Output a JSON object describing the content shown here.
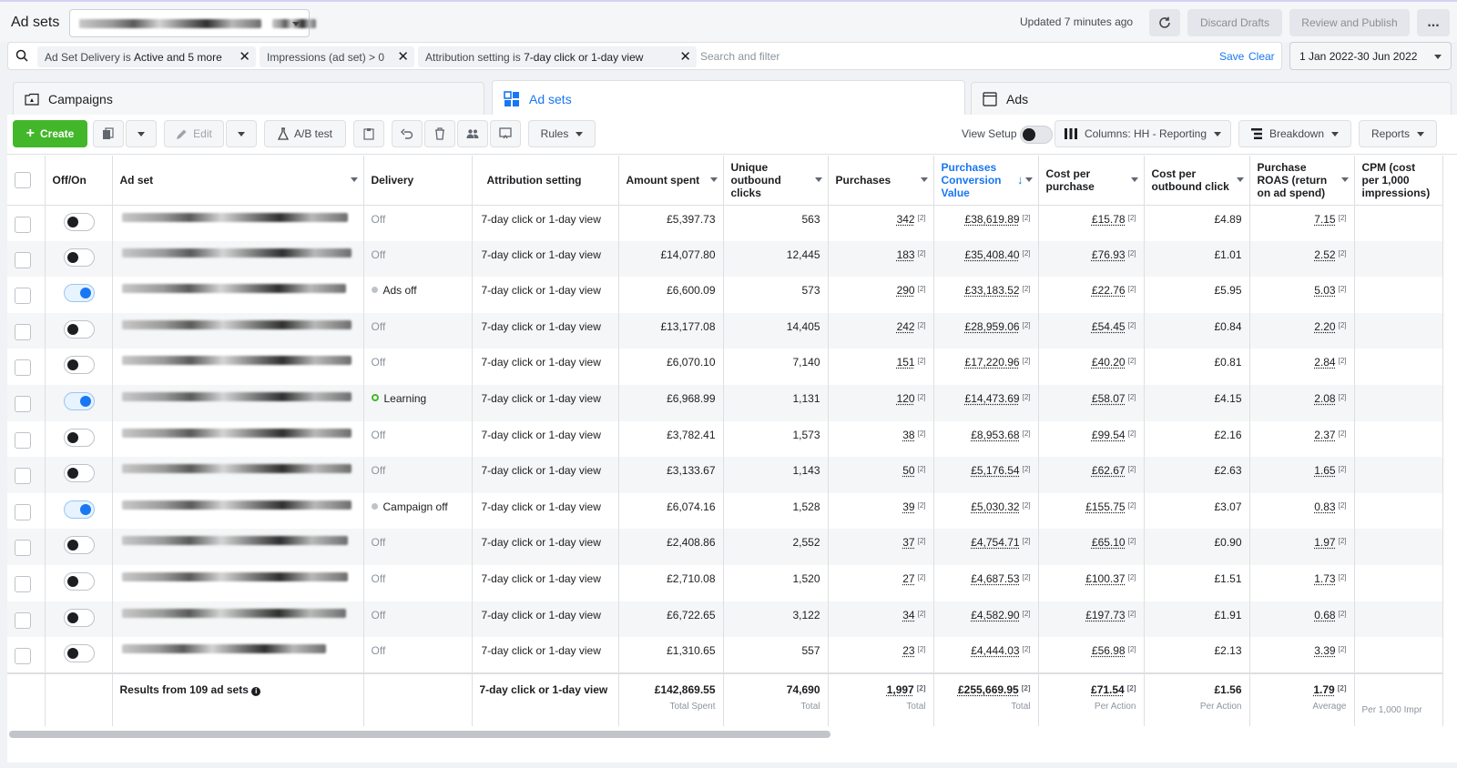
{
  "header": {
    "title": "Ad sets",
    "updated": "Updated 7 minutes ago",
    "discard": "Discard Drafts",
    "review": "Review and Publish",
    "more": "..."
  },
  "filters": {
    "chip1_prefix": "Ad Set Delivery is ",
    "chip1_value": "Active and 5 more",
    "chip2": "Impressions (ad set) > 0",
    "chip3_prefix": "Attribution setting is ",
    "chip3_value": "7-day click or 1-day view",
    "placeholder": "Search and filter",
    "save": "Save",
    "clear": "Clear",
    "date_range": "1 Jan 2022-30 Jun 2022"
  },
  "tabs": {
    "campaigns": "Campaigns",
    "adsets": "Ad sets",
    "ads": "Ads"
  },
  "toolbar": {
    "create": "Create",
    "edit": "Edit",
    "ab_test": "A/B test",
    "rules": "Rules",
    "view_setup": "View Setup",
    "columns": "Columns: HH - Reporting",
    "breakdown": "Breakdown",
    "reports": "Reports"
  },
  "columns": {
    "offon": "Off/On",
    "adset": "Ad set",
    "delivery": "Delivery",
    "attribution": "Attribution setting",
    "spent": "Amount spent",
    "clicks": "Unique outbound clicks",
    "purchases": "Purchases",
    "conv_value": "Purchases Conversion Value",
    "cpp": "Cost per purchase",
    "cpoc": "Cost per outbound click",
    "roas": "Purchase ROAS (return on ad spend)",
    "cpm": "CPM (cost per 1,000 impressions)"
  },
  "rows": [
    {
      "on": false,
      "delivery": "Off",
      "status": "",
      "attribution": "7-day click or 1-day view",
      "spent": "£5,397.73",
      "clicks": "563",
      "purchases": "342",
      "value": "£38,619.89",
      "cpp": "£15.78",
      "cpoc": "£4.89",
      "roas": "7.15"
    },
    {
      "on": false,
      "delivery": "Off",
      "status": "",
      "attribution": "7-day click or 1-day view",
      "spent": "£14,077.80",
      "clicks": "12,445",
      "purchases": "183",
      "value": "£35,408.40",
      "cpp": "£76.93",
      "cpoc": "£1.01",
      "roas": "2.52"
    },
    {
      "on": true,
      "delivery": "Ads off",
      "status": "dot",
      "attribution": "7-day click or 1-day view",
      "spent": "£6,600.09",
      "clicks": "573",
      "purchases": "290",
      "value": "£33,183.52",
      "cpp": "£22.76",
      "cpoc": "£5.95",
      "roas": "5.03"
    },
    {
      "on": false,
      "delivery": "Off",
      "status": "",
      "attribution": "7-day click or 1-day view",
      "spent": "£13,177.08",
      "clicks": "14,405",
      "purchases": "242",
      "value": "£28,959.06",
      "cpp": "£54.45",
      "cpoc": "£0.84",
      "roas": "2.20"
    },
    {
      "on": false,
      "delivery": "Off",
      "status": "",
      "attribution": "7-day click or 1-day view",
      "spent": "£6,070.10",
      "clicks": "7,140",
      "purchases": "151",
      "value": "£17,220.96",
      "cpp": "£40.20",
      "cpoc": "£0.81",
      "roas": "2.84"
    },
    {
      "on": true,
      "delivery": "Learning",
      "status": "learn",
      "attribution": "7-day click or 1-day view",
      "spent": "£6,968.99",
      "clicks": "1,131",
      "purchases": "120",
      "value": "£14,473.69",
      "cpp": "£58.07",
      "cpoc": "£4.15",
      "roas": "2.08"
    },
    {
      "on": false,
      "delivery": "Off",
      "status": "",
      "attribution": "7-day click or 1-day view",
      "spent": "£3,782.41",
      "clicks": "1,573",
      "purchases": "38",
      "value": "£8,953.68",
      "cpp": "£99.54",
      "cpoc": "£2.16",
      "roas": "2.37"
    },
    {
      "on": false,
      "delivery": "Off",
      "status": "",
      "attribution": "7-day click or 1-day view",
      "spent": "£3,133.67",
      "clicks": "1,143",
      "purchases": "50",
      "value": "£5,176.54",
      "cpp": "£62.67",
      "cpoc": "£2.63",
      "roas": "1.65"
    },
    {
      "on": true,
      "delivery": "Campaign off",
      "status": "dot",
      "attribution": "7-day click or 1-day view",
      "spent": "£6,074.16",
      "clicks": "1,528",
      "purchases": "39",
      "value": "£5,030.32",
      "cpp": "£155.75",
      "cpoc": "£3.07",
      "roas": "0.83"
    },
    {
      "on": false,
      "delivery": "Off",
      "status": "",
      "attribution": "7-day click or 1-day view",
      "spent": "£2,408.86",
      "clicks": "2,552",
      "purchases": "37",
      "value": "£4,754.71",
      "cpp": "£65.10",
      "cpoc": "£0.90",
      "roas": "1.97"
    },
    {
      "on": false,
      "delivery": "Off",
      "status": "",
      "attribution": "7-day click or 1-day view",
      "spent": "£2,710.08",
      "clicks": "1,520",
      "purchases": "27",
      "value": "£4,687.53",
      "cpp": "£100.37",
      "cpoc": "£1.51",
      "roas": "1.73"
    },
    {
      "on": false,
      "delivery": "Off",
      "status": "",
      "attribution": "7-day click or 1-day view",
      "spent": "£6,722.65",
      "clicks": "3,122",
      "purchases": "34",
      "value": "£4,582.90",
      "cpp": "£197.73",
      "cpoc": "£1.91",
      "roas": "0.68"
    },
    {
      "on": false,
      "delivery": "Off",
      "status": "",
      "attribution": "7-day click or 1-day view",
      "spent": "£1,310.65",
      "clicks": "557",
      "purchases": "23",
      "value": "£4,444.03",
      "cpp": "£56.98",
      "cpoc": "£2.13",
      "roas": "3.39"
    }
  ],
  "totals": {
    "label": "Results from 109 ad sets",
    "attribution": "7-day click or 1-day view",
    "spent": "£142,869.55",
    "spent_sub": "Total Spent",
    "clicks": "74,690",
    "clicks_sub": "Total",
    "purchases": "1,997",
    "purchases_sub": "Total",
    "value": "£255,669.95",
    "value_sub": "Total",
    "cpp": "£71.54",
    "cpp_sub": "Per Action",
    "cpoc": "£1.56",
    "cpoc_sub": "Per Action",
    "roas": "1.79",
    "roas_sub": "Average",
    "cpm_sub": "Per 1,000 Impr"
  },
  "colors": {
    "accent": "#1877f2",
    "create": "#42b72a",
    "learning": "#42b72a"
  },
  "icons": [
    "search-icon",
    "refresh-icon",
    "close-icon",
    "campaigns-icon",
    "adsets-icon",
    "ads-icon",
    "duplicate-icon",
    "pencil-icon",
    "flask-icon",
    "clipboard-icon",
    "undo-icon",
    "trash-icon",
    "audience-icon",
    "preview-icon",
    "columns-icon",
    "breakdown-icon",
    "info-icon"
  ]
}
